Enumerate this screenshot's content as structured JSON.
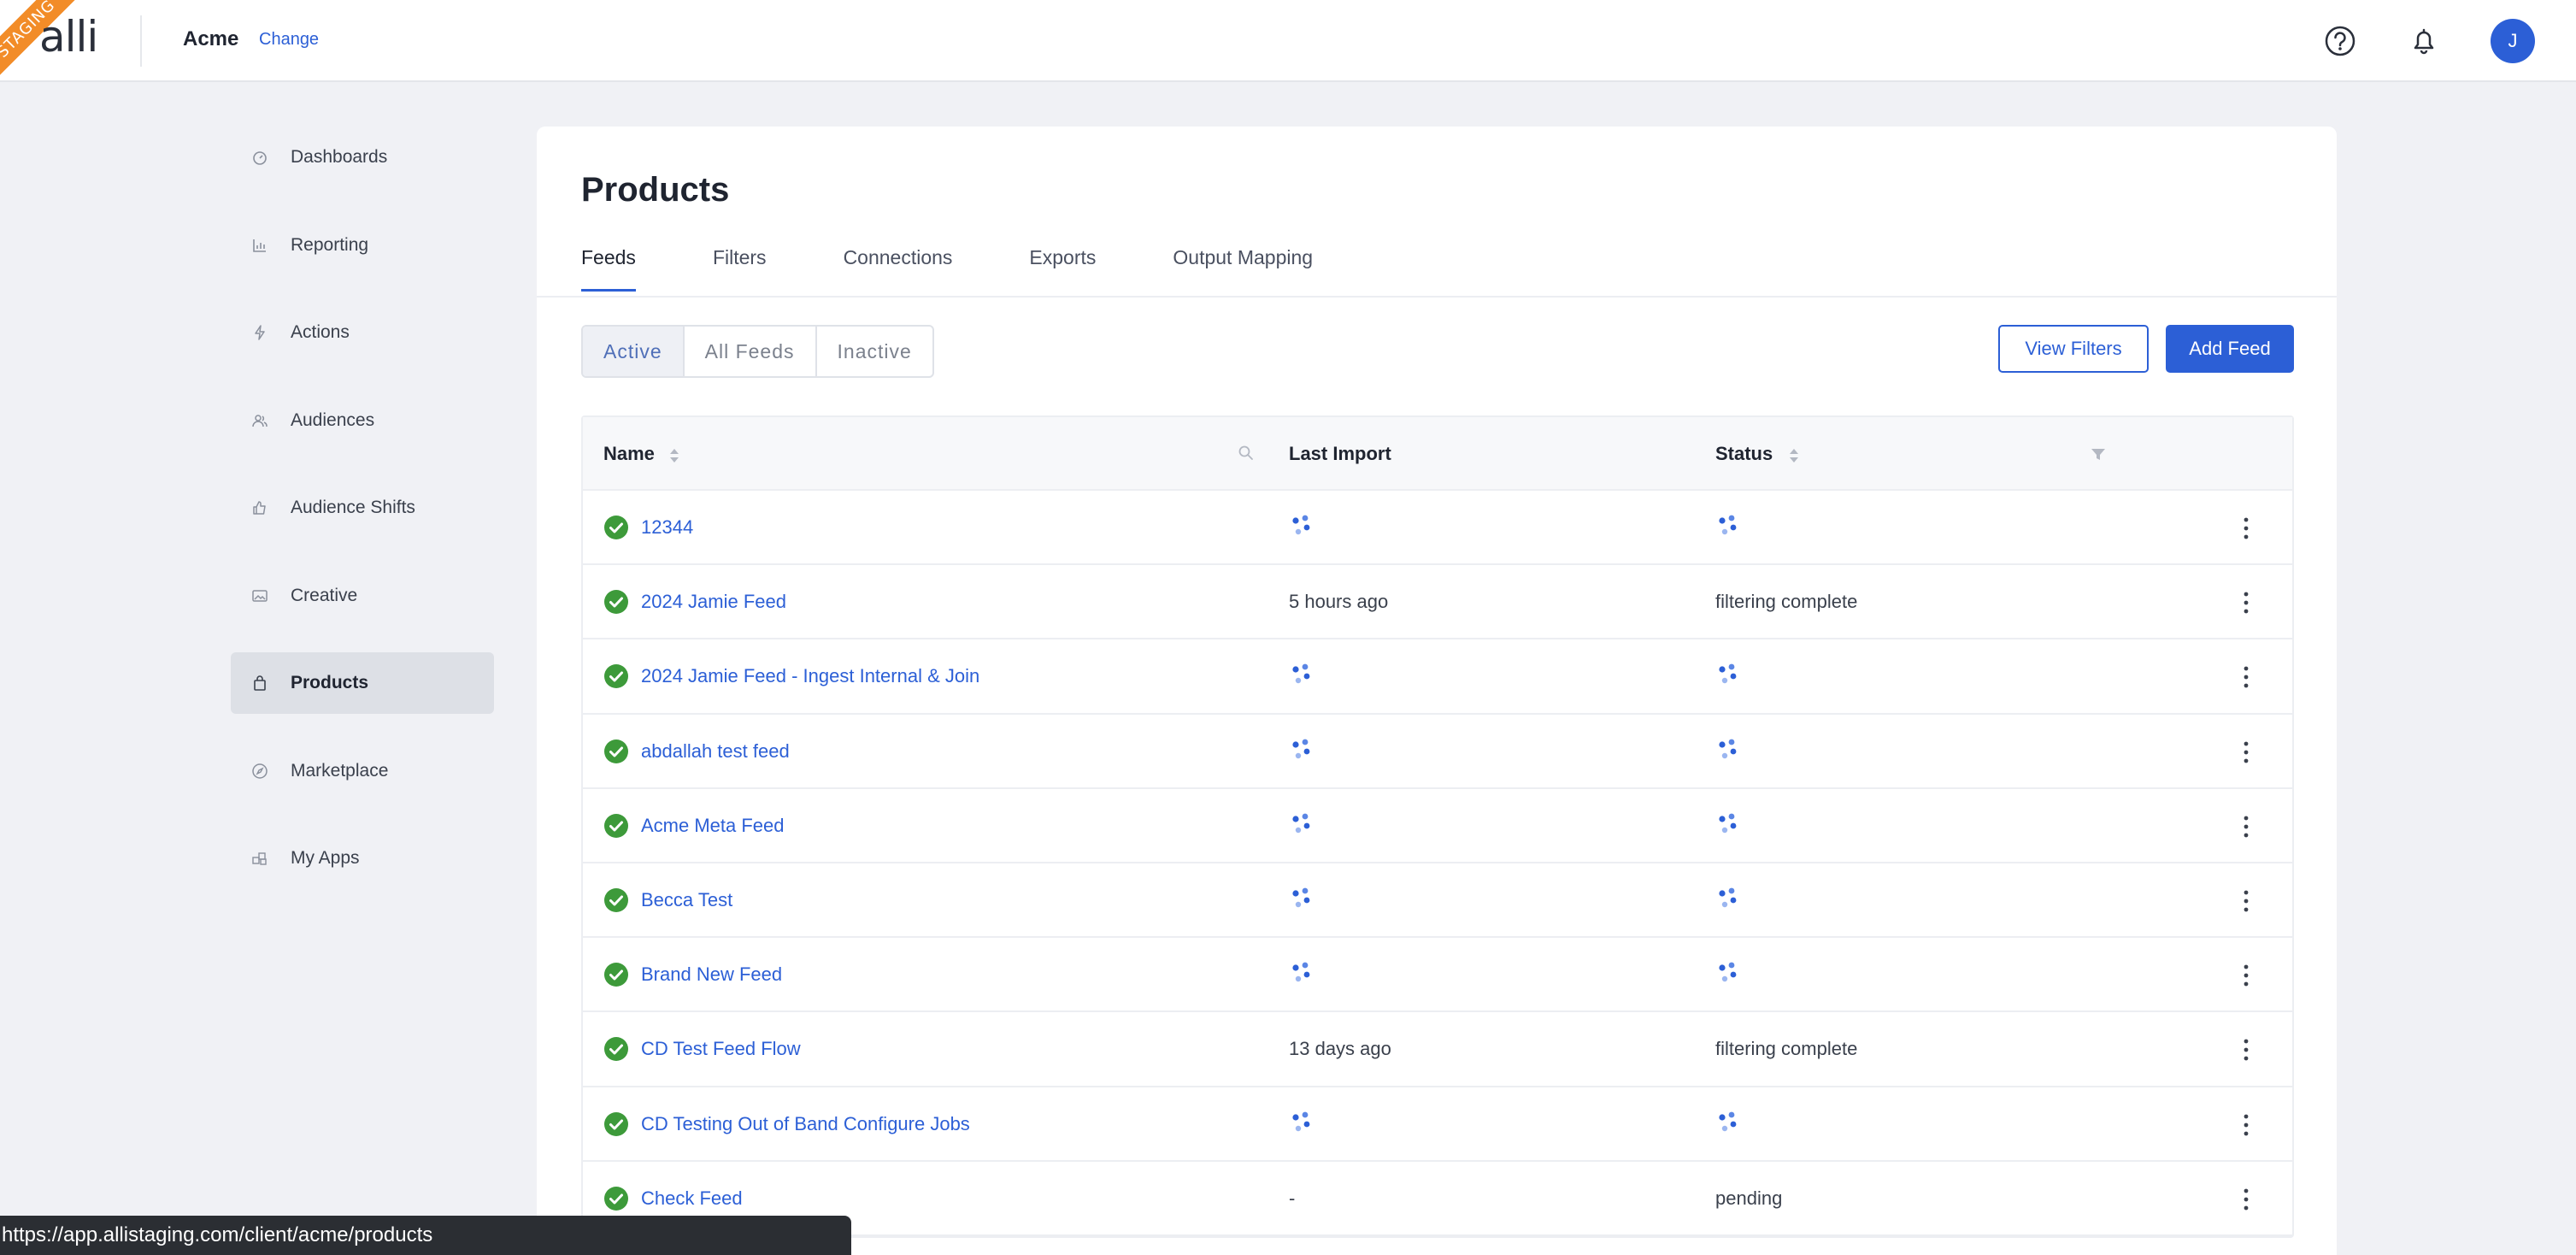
{
  "topbar": {
    "ribbon": "STAGING",
    "logo": "alli",
    "org_name": "Acme",
    "change_label": "Change",
    "avatar_initial": "J"
  },
  "sidebar": {
    "items": [
      {
        "label": "Dashboards",
        "icon": "dashboard-icon"
      },
      {
        "label": "Reporting",
        "icon": "bar-chart-icon"
      },
      {
        "label": "Actions",
        "icon": "lightning-icon"
      },
      {
        "label": "Audiences",
        "icon": "people-icon"
      },
      {
        "label": "Audience Shifts",
        "icon": "thumbs-up-icon"
      },
      {
        "label": "Creative",
        "icon": "image-icon"
      },
      {
        "label": "Products",
        "icon": "shopping-bag-icon",
        "active": true
      },
      {
        "label": "Marketplace",
        "icon": "compass-icon"
      },
      {
        "label": "My Apps",
        "icon": "apps-icon"
      }
    ]
  },
  "main": {
    "title": "Products",
    "tabs": [
      {
        "label": "Feeds",
        "active": true
      },
      {
        "label": "Filters"
      },
      {
        "label": "Connections"
      },
      {
        "label": "Exports"
      },
      {
        "label": "Output Mapping"
      }
    ],
    "segments": [
      {
        "label": "Active",
        "active": true
      },
      {
        "label": "All Feeds"
      },
      {
        "label": "Inactive"
      }
    ],
    "view_filters_label": "View Filters",
    "add_feed_label": "Add Feed"
  },
  "table": {
    "headers": {
      "name": "Name",
      "last_import": "Last Import",
      "status": "Status"
    },
    "rows": [
      {
        "name": "12344",
        "last_import": null,
        "status": null
      },
      {
        "name": "2024 Jamie Feed",
        "last_import": "5 hours ago",
        "status": "filtering complete"
      },
      {
        "name": "2024 Jamie Feed - Ingest Internal & Join",
        "last_import": null,
        "status": null
      },
      {
        "name": "abdallah test feed",
        "last_import": null,
        "status": null
      },
      {
        "name": "Acme Meta Feed",
        "last_import": null,
        "status": null
      },
      {
        "name": "Becca Test",
        "last_import": null,
        "status": null
      },
      {
        "name": "Brand New Feed",
        "last_import": null,
        "status": null
      },
      {
        "name": "CD Test Feed Flow",
        "last_import": "13 days ago",
        "status": "filtering complete"
      },
      {
        "name": "CD Testing Out of Band Configure Jobs",
        "last_import": null,
        "status": null
      },
      {
        "name": "Check Feed",
        "last_import": "-",
        "status": "pending"
      }
    ]
  },
  "status_bar": {
    "url": "https://app.allistaging.com/client/acme/products"
  },
  "colors": {
    "accent": "#2c5fd6",
    "success": "#3d9a3a",
    "ribbon": "#f28c28",
    "background": "#f0f1f5"
  }
}
